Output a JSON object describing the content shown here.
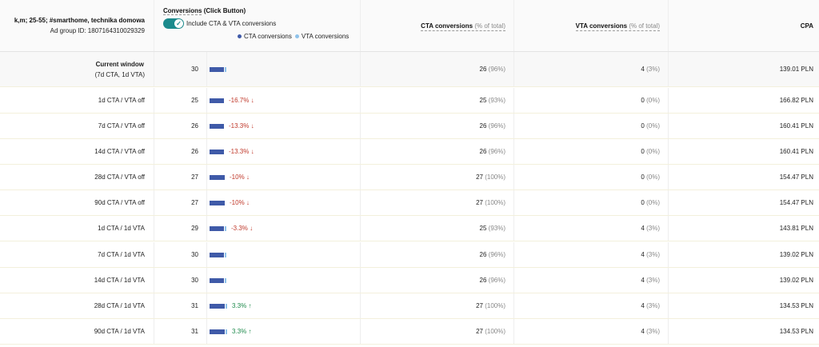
{
  "header": {
    "campaign_name": "k,m; 25-55; #smarthome, technika domowa",
    "ad_group_id": "Ad group ID: 1807164310029329",
    "conversions_title": "Conversions",
    "conversions_suffix": "(Click Button)",
    "toggle_label": "Include CTA & VTA conversions",
    "toggle_on": true,
    "legend_cta": "CTA conversions",
    "legend_vta": "VTA conversions",
    "cta_col": "CTA conversions",
    "cta_col_pct": "(% of total)",
    "vta_col": "VTA conversions",
    "vta_col_pct": "(% of total)",
    "cpa_col": "CPA"
  },
  "colors": {
    "cta": "#3f5aa8",
    "vta": "#8fc2ea",
    "toggle": "#1b8a8c",
    "down": "#c0392b",
    "up": "#1e8a4c"
  },
  "current": {
    "label_line1": "Current window",
    "label_line2": "(7d CTA, 1d VTA)",
    "total": "30",
    "cta_value": 26,
    "vta_value": 4,
    "cta": "26",
    "cta_pct": "(96%)",
    "vta": "4",
    "vta_pct": "(3%)",
    "cpa": "139.01 PLN"
  },
  "rows": [
    {
      "window": "1d CTA / VTA off",
      "total": "25",
      "cta_value": 25,
      "vta_value": 0,
      "change": "-16.7% ↓",
      "dir": "down",
      "cta": "25",
      "cta_pct": "(93%)",
      "vta": "0",
      "vta_pct": "(0%)",
      "cpa": "166.82 PLN"
    },
    {
      "window": "7d CTA / VTA off",
      "total": "26",
      "cta_value": 26,
      "vta_value": 0,
      "change": "-13.3% ↓",
      "dir": "down",
      "cta": "26",
      "cta_pct": "(96%)",
      "vta": "0",
      "vta_pct": "(0%)",
      "cpa": "160.41 PLN"
    },
    {
      "window": "14d CTA / VTA off",
      "total": "26",
      "cta_value": 26,
      "vta_value": 0,
      "change": "-13.3% ↓",
      "dir": "down",
      "cta": "26",
      "cta_pct": "(96%)",
      "vta": "0",
      "vta_pct": "(0%)",
      "cpa": "160.41 PLN"
    },
    {
      "window": "28d CTA / VTA off",
      "total": "27",
      "cta_value": 27,
      "vta_value": 0,
      "change": "-10% ↓",
      "dir": "down",
      "cta": "27",
      "cta_pct": "(100%)",
      "vta": "0",
      "vta_pct": "(0%)",
      "cpa": "154.47 PLN"
    },
    {
      "window": "90d CTA / VTA off",
      "total": "27",
      "cta_value": 27,
      "vta_value": 0,
      "change": "-10% ↓",
      "dir": "down",
      "cta": "27",
      "cta_pct": "(100%)",
      "vta": "0",
      "vta_pct": "(0%)",
      "cpa": "154.47 PLN"
    },
    {
      "window": "1d CTA / 1d VTA",
      "total": "29",
      "cta_value": 25,
      "vta_value": 4,
      "change": "-3.3% ↓",
      "dir": "down",
      "cta": "25",
      "cta_pct": "(93%)",
      "vta": "4",
      "vta_pct": "(3%)",
      "cpa": "143.81 PLN"
    },
    {
      "window": "7d CTA / 1d VTA",
      "total": "30",
      "cta_value": 26,
      "vta_value": 4,
      "change": "",
      "dir": "none",
      "cta": "26",
      "cta_pct": "(96%)",
      "vta": "4",
      "vta_pct": "(3%)",
      "cpa": "139.02 PLN"
    },
    {
      "window": "14d CTA / 1d VTA",
      "total": "30",
      "cta_value": 26,
      "vta_value": 4,
      "change": "",
      "dir": "none",
      "cta": "26",
      "cta_pct": "(96%)",
      "vta": "4",
      "vta_pct": "(3%)",
      "cpa": "139.02 PLN"
    },
    {
      "window": "28d CTA / 1d VTA",
      "total": "31",
      "cta_value": 27,
      "vta_value": 4,
      "change": "3.3% ↑",
      "dir": "up",
      "cta": "27",
      "cta_pct": "(100%)",
      "vta": "4",
      "vta_pct": "(3%)",
      "cpa": "134.53 PLN"
    },
    {
      "window": "90d CTA / 1d VTA",
      "total": "31",
      "cta_value": 27,
      "vta_value": 4,
      "change": "3.3% ↑",
      "dir": "up",
      "cta": "27",
      "cta_pct": "(100%)",
      "vta": "4",
      "vta_pct": "(3%)",
      "cpa": "134.53 PLN"
    }
  ]
}
